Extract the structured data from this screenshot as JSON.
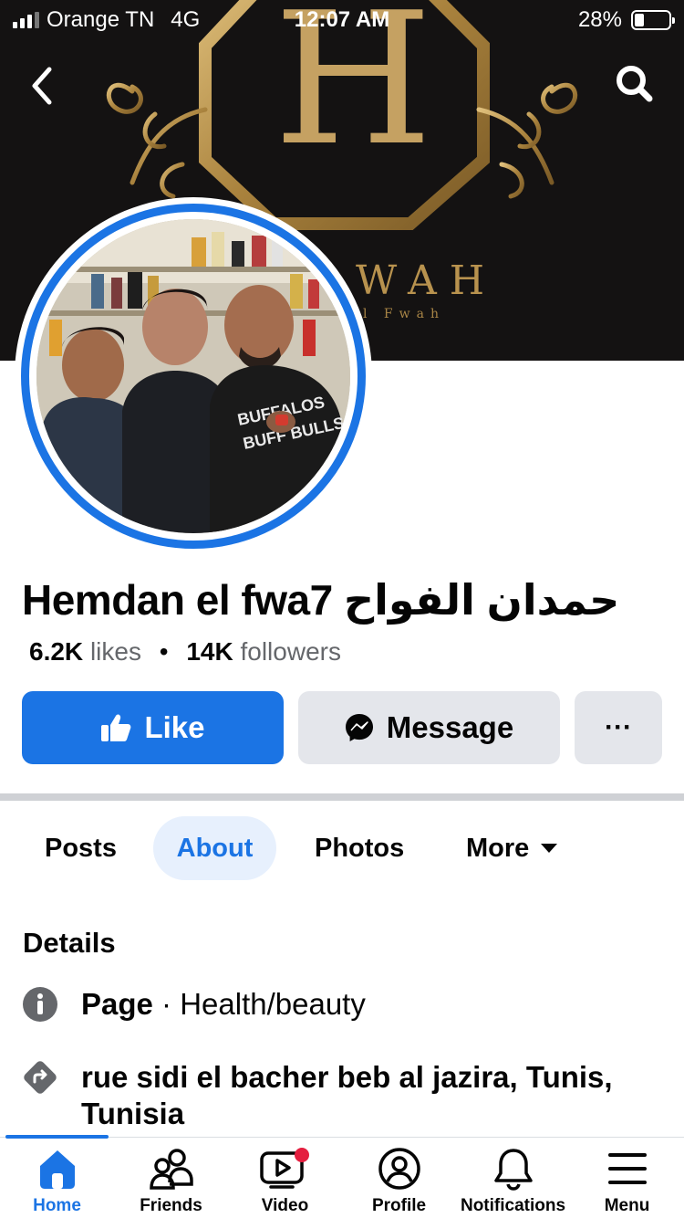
{
  "status_bar": {
    "carrier": "Orange TN",
    "network": "4G",
    "time": "12:07 AM",
    "battery_percent": "28%",
    "battery_level": 0.28,
    "signal_bars": 3
  },
  "cover": {
    "logo_letter": "H",
    "logo_text": "WAH",
    "logo_subtext": "l Fwah",
    "back_icon": "chevron-left-icon",
    "search_icon": "search-icon"
  },
  "profile": {
    "name": "Hemdan el fwa7 حمدان الفواح",
    "likes_count": "6.2K",
    "likes_label": "likes",
    "dot": "•",
    "followers_count": "14K",
    "followers_label": "followers"
  },
  "actions": {
    "like_label": "Like",
    "message_label": "Message",
    "more_label": "···"
  },
  "tabs": [
    {
      "label": "Posts"
    },
    {
      "label": "About"
    },
    {
      "label": "Photos"
    },
    {
      "label": "More"
    }
  ],
  "details": {
    "title": "Details",
    "category_prefix": "Page",
    "category_separator": " · ",
    "category": "Health/beauty",
    "address_line1": "rue sidi el bacher beb al jazira, Tunis,",
    "address_line2": "Tunisia"
  },
  "bottom_nav": [
    {
      "label": "Home",
      "icon": "home-icon"
    },
    {
      "label": "Friends",
      "icon": "friends-icon"
    },
    {
      "label": "Video",
      "icon": "video-icon"
    },
    {
      "label": "Profile",
      "icon": "profile-icon"
    },
    {
      "label": "Notifications",
      "icon": "bell-icon"
    },
    {
      "label": "Menu",
      "icon": "menu-icon"
    }
  ],
  "colors": {
    "accent": "#1b74e4",
    "button_gray": "#e4e6eb",
    "text": "#050505",
    "muted": "#65676b",
    "gold": "#b8924e",
    "notification_dot": "#e41e3f"
  }
}
